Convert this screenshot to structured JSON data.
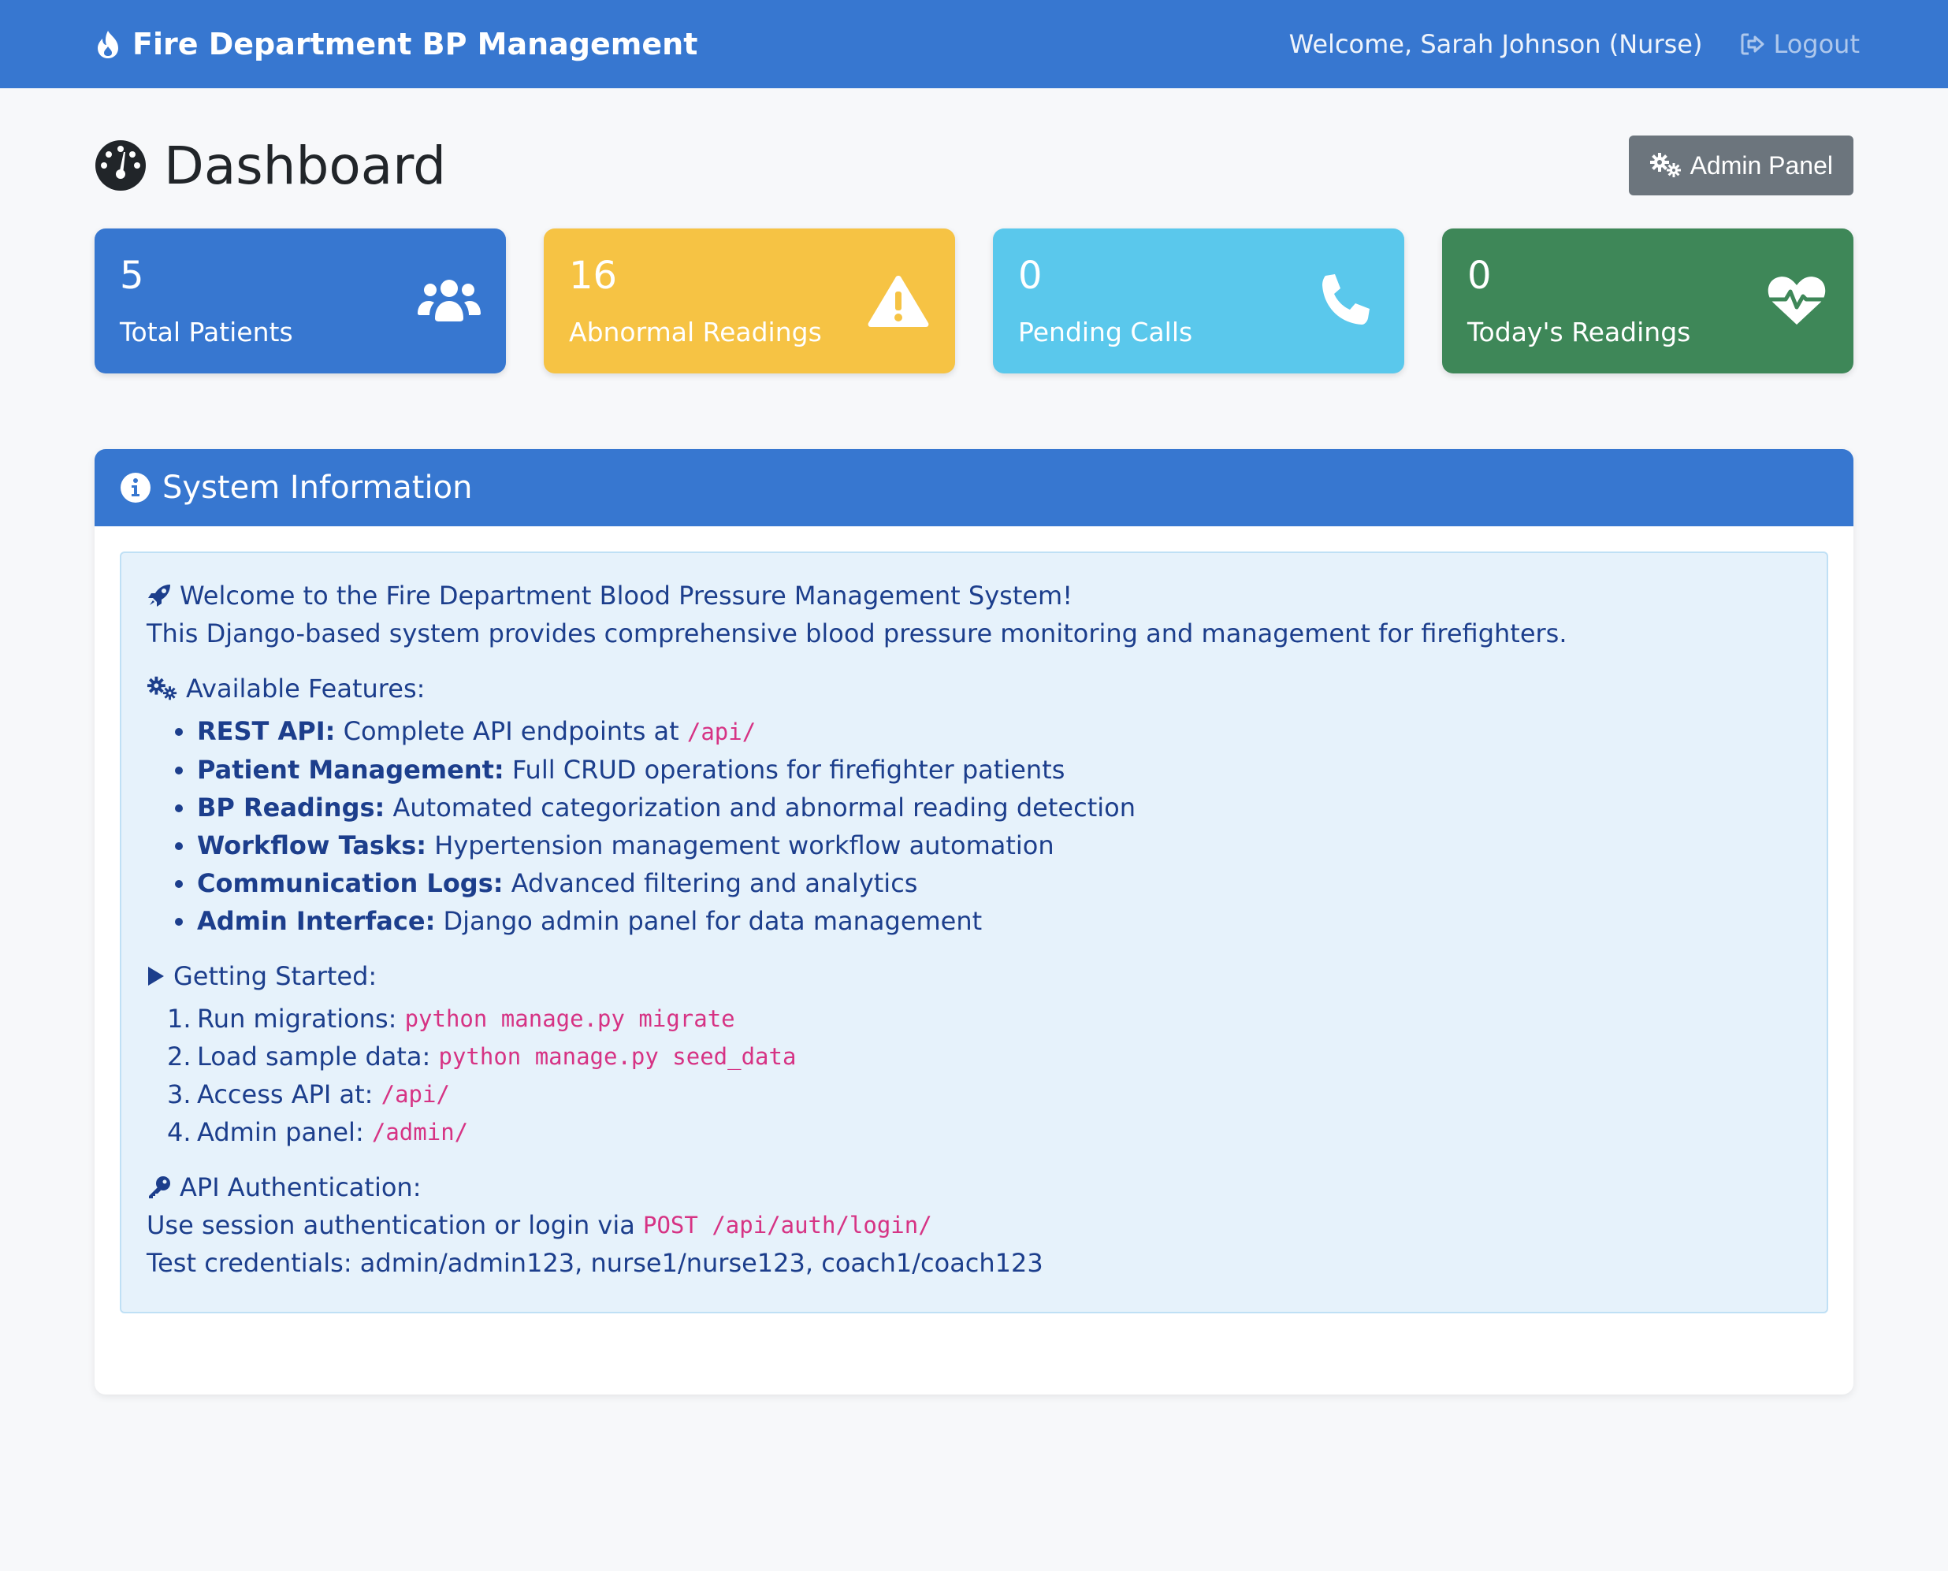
{
  "navbar": {
    "brand": "Fire Department BP Management",
    "welcome": "Welcome, Sarah Johnson (Nurse)",
    "logout": "Logout"
  },
  "page": {
    "title": "Dashboard",
    "admin_button": "Admin Panel"
  },
  "stats": [
    {
      "value": "5",
      "label": "Total Patients",
      "icon": "users-icon",
      "color": "#3777d0"
    },
    {
      "value": "16",
      "label": "Abnormal Readings",
      "icon": "warning-icon",
      "color": "#f6c344"
    },
    {
      "value": "0",
      "label": "Pending Calls",
      "icon": "phone-icon",
      "color": "#5ac8ec"
    },
    {
      "value": "0",
      "label": "Today's Readings",
      "icon": "heartbeat-icon",
      "color": "#3e8758"
    }
  ],
  "system_info": {
    "title": "System Information",
    "welcome": "Welcome to the Fire Department Blood Pressure Management System!",
    "description": "This Django-based system provides comprehensive blood pressure monitoring and management for firefighters.",
    "features_title": "Available Features:",
    "features": [
      {
        "name": "REST API:",
        "text": "Complete API endpoints at",
        "code": "/api/"
      },
      {
        "name": "Patient Management:",
        "text": "Full CRUD operations for firefighter patients"
      },
      {
        "name": "BP Readings:",
        "text": "Automated categorization and abnormal reading detection"
      },
      {
        "name": "Workflow Tasks:",
        "text": "Hypertension management workflow automation"
      },
      {
        "name": "Communication Logs:",
        "text": "Advanced filtering and analytics"
      },
      {
        "name": "Admin Interface:",
        "text": "Django admin panel for data management"
      }
    ],
    "getting_started_title": "Getting Started:",
    "steps": [
      {
        "num": "1.",
        "text": "Run migrations:",
        "code": "python manage.py migrate"
      },
      {
        "num": "2.",
        "text": "Load sample data:",
        "code": "python manage.py seed_data"
      },
      {
        "num": "3.",
        "text": "Access API at:",
        "code": "/api/"
      },
      {
        "num": "4.",
        "text": "Admin panel:",
        "code": "/admin/"
      }
    ],
    "auth_title": "API Authentication:",
    "auth_text": "Use session authentication or login via",
    "auth_code": "POST /api/auth/login/",
    "credentials": "Test credentials: admin/admin123, nurse1/nurse123, coach1/coach123"
  }
}
